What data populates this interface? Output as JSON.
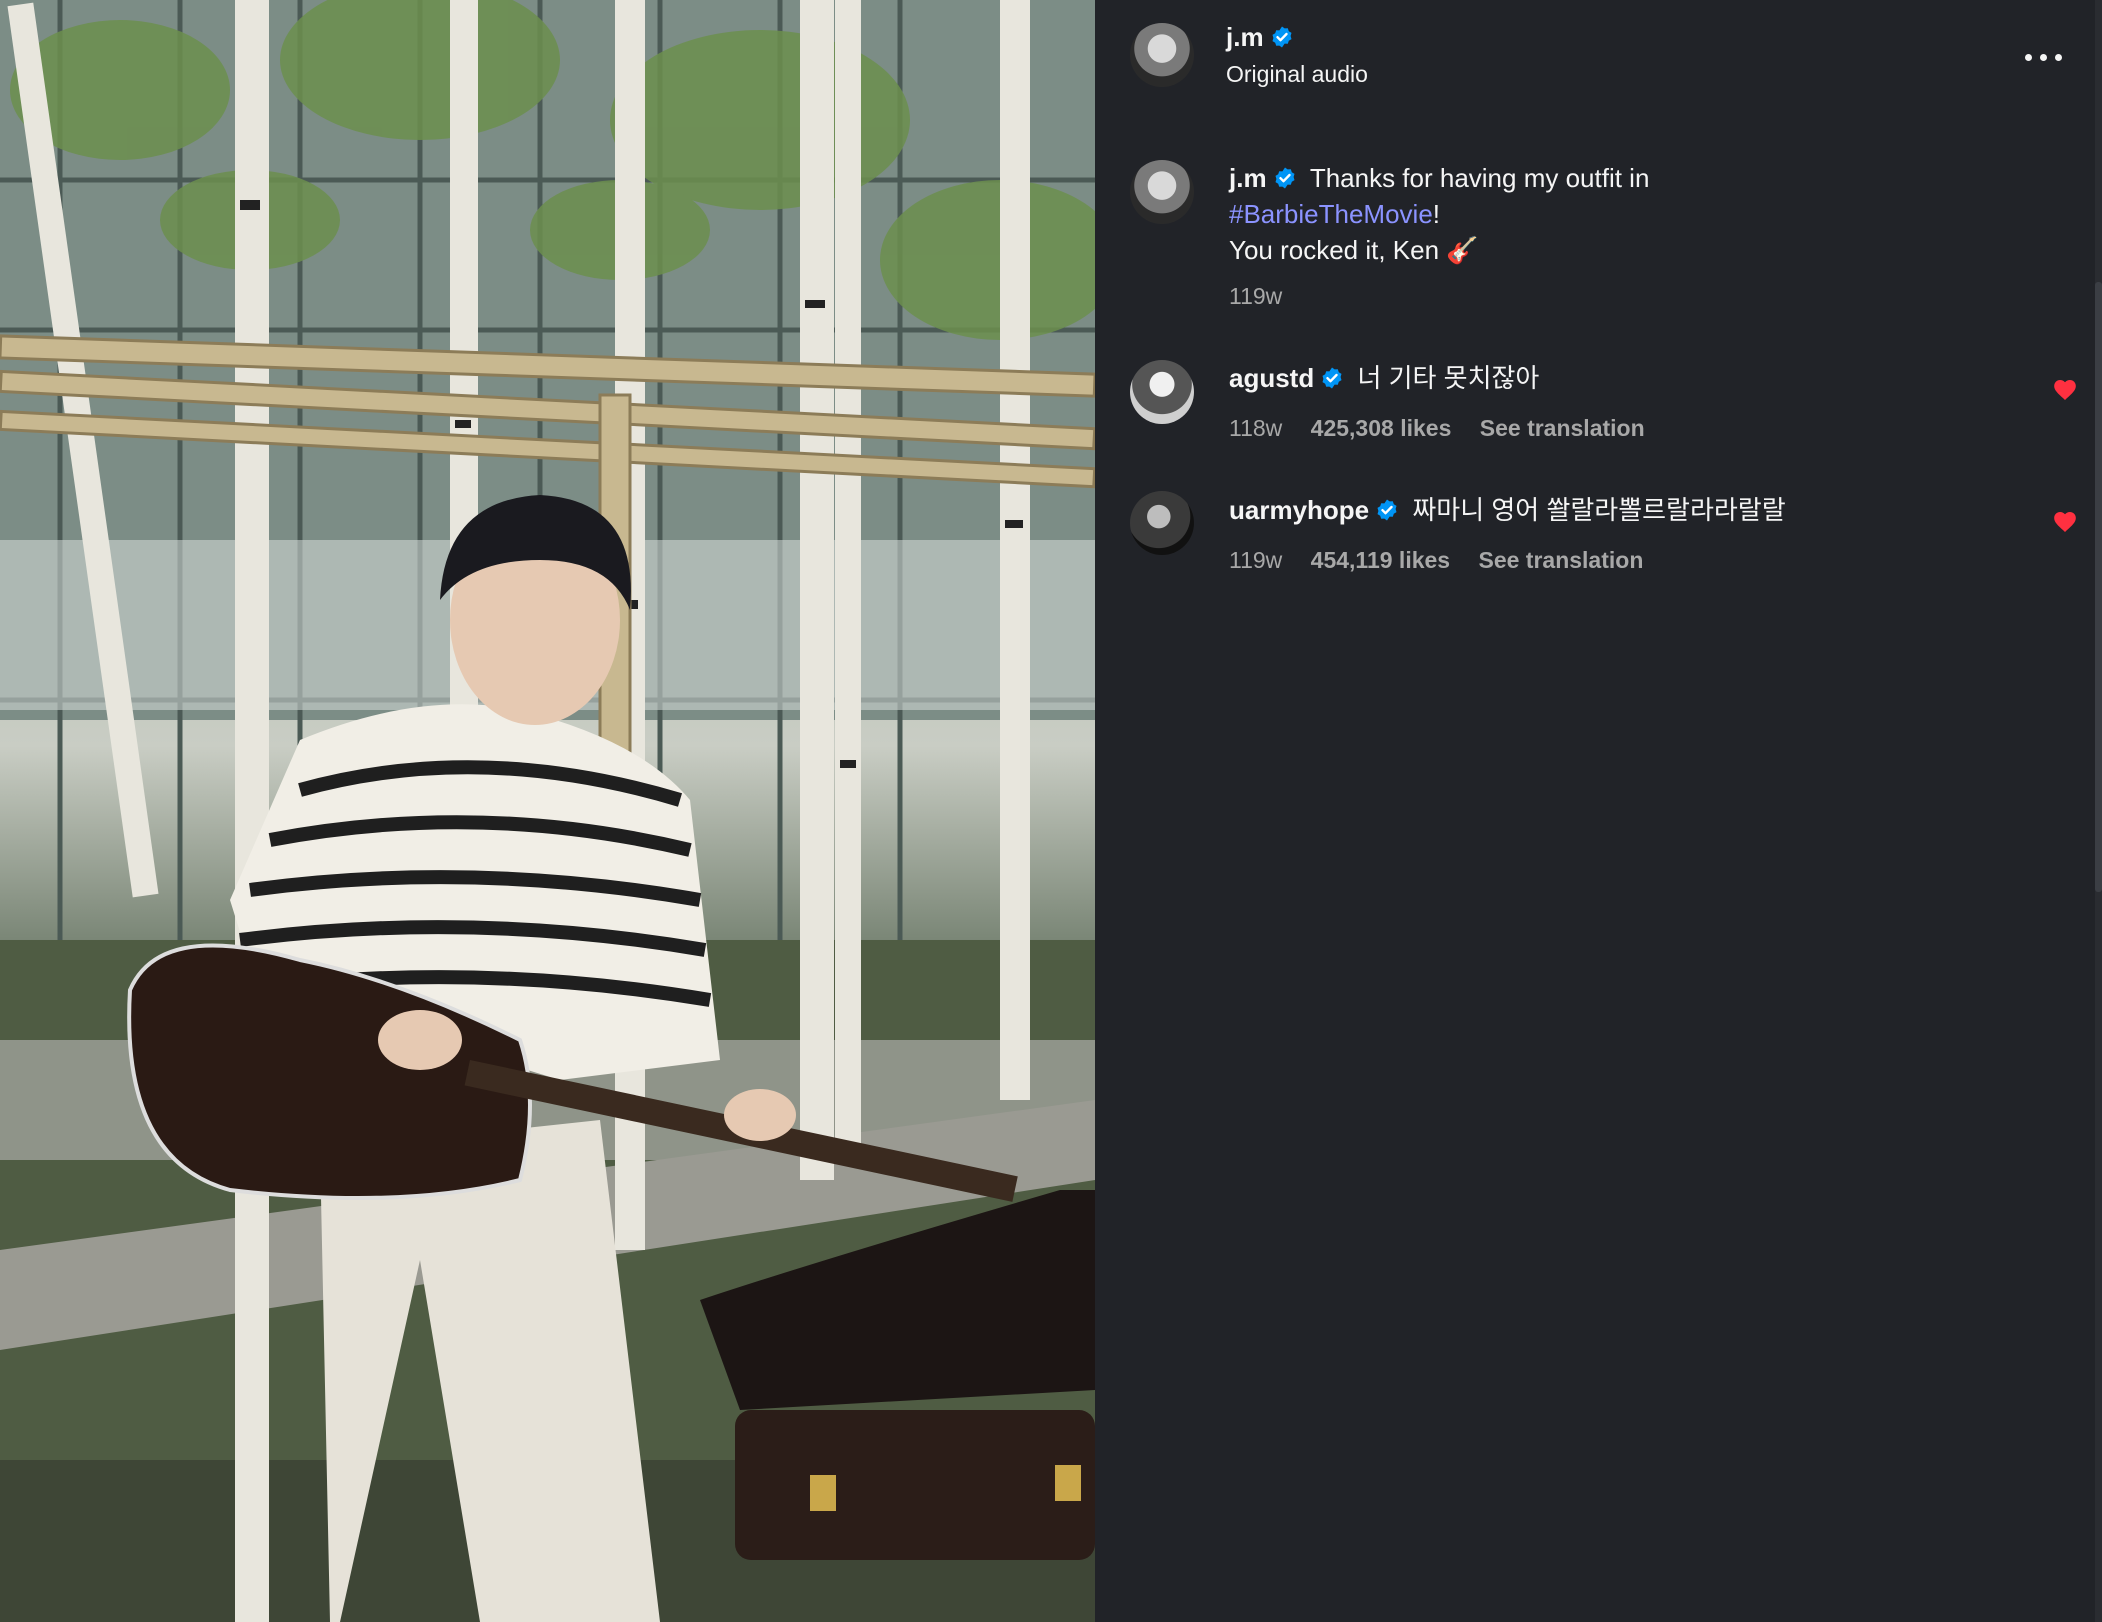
{
  "header": {
    "username": "j.m",
    "subtitle": "Original audio"
  },
  "caption": {
    "username": "j.m",
    "text_part1": "Thanks for having my outfit in",
    "hashtag": "#BarbieTheMovie",
    "text_part2": "!",
    "line2": "You rocked it, Ken 🎸",
    "time": "119w"
  },
  "comments": [
    {
      "username": "agustd",
      "text": "너 기타 못치잖아",
      "time": "118w",
      "likes": "425,308 likes",
      "translate": "See translation",
      "liked": true
    },
    {
      "username": "uarmyhope",
      "text": "짜마니 영어 쏼랄라뽈르랄라라랄랄",
      "time": "119w",
      "likes": "454,119 likes",
      "translate": "See translation",
      "liked": true
    }
  ],
  "colors": {
    "panel_bg": "#212328",
    "verified": "#0095f6",
    "hashtag": "#8b93ff",
    "heart": "#ff3040",
    "muted_text": "#a8a8a8"
  },
  "icons": {
    "verified": "verified-badge-icon",
    "more": "more-options-icon",
    "like": "heart-icon"
  }
}
